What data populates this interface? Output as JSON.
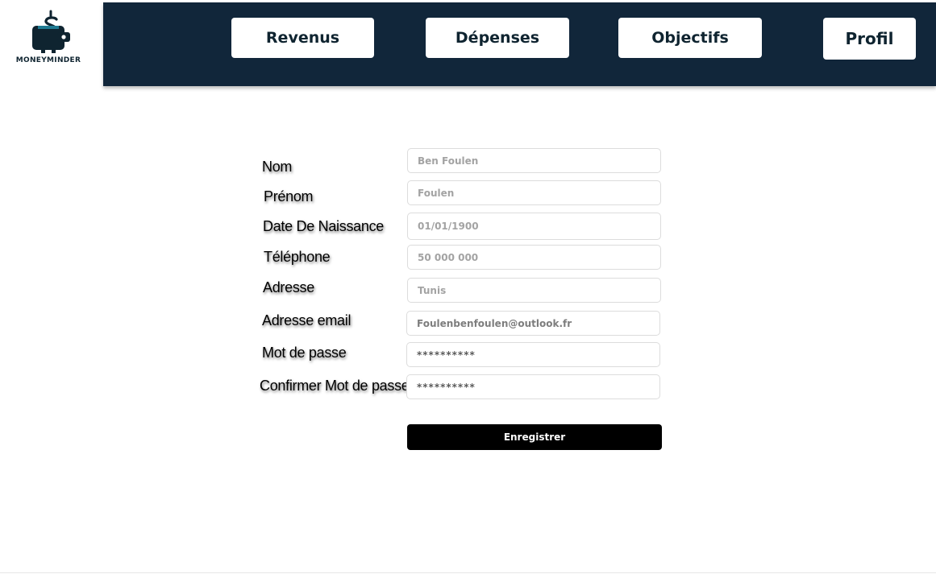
{
  "app": {
    "brand_name": "MONEYMINDER"
  },
  "nav": {
    "revenus": "Revenus",
    "depenses": "Dépenses",
    "objectifs": "Objectifs",
    "profil": "Profil"
  },
  "form": {
    "nom": {
      "label": "Nom",
      "value": "Ben Foulen"
    },
    "prenom": {
      "label": "Prénom",
      "value": "Foulen"
    },
    "date_naissance": {
      "label": "Date De Naissance",
      "value": "01/01/1900"
    },
    "telephone": {
      "label": "Téléphone",
      "value": "50 000 000"
    },
    "adresse": {
      "label": "Adresse",
      "value": "Tunis"
    },
    "email": {
      "label": "Adresse email",
      "value": "Foulenbenfoulen@outlook.fr"
    },
    "mot_de_passe": {
      "label": "Mot de passe",
      "value": "**********"
    },
    "confirmer_mot_de_passe": {
      "label": "Confirmer Mot de  passe",
      "value": "**********"
    },
    "submit_label": "Enregistrer"
  },
  "colors": {
    "navbar": "#11263a",
    "brand_dark": "#0f2430",
    "submit_button": "#000000"
  },
  "icons": {
    "logo": "wallet-dollar-icon"
  }
}
